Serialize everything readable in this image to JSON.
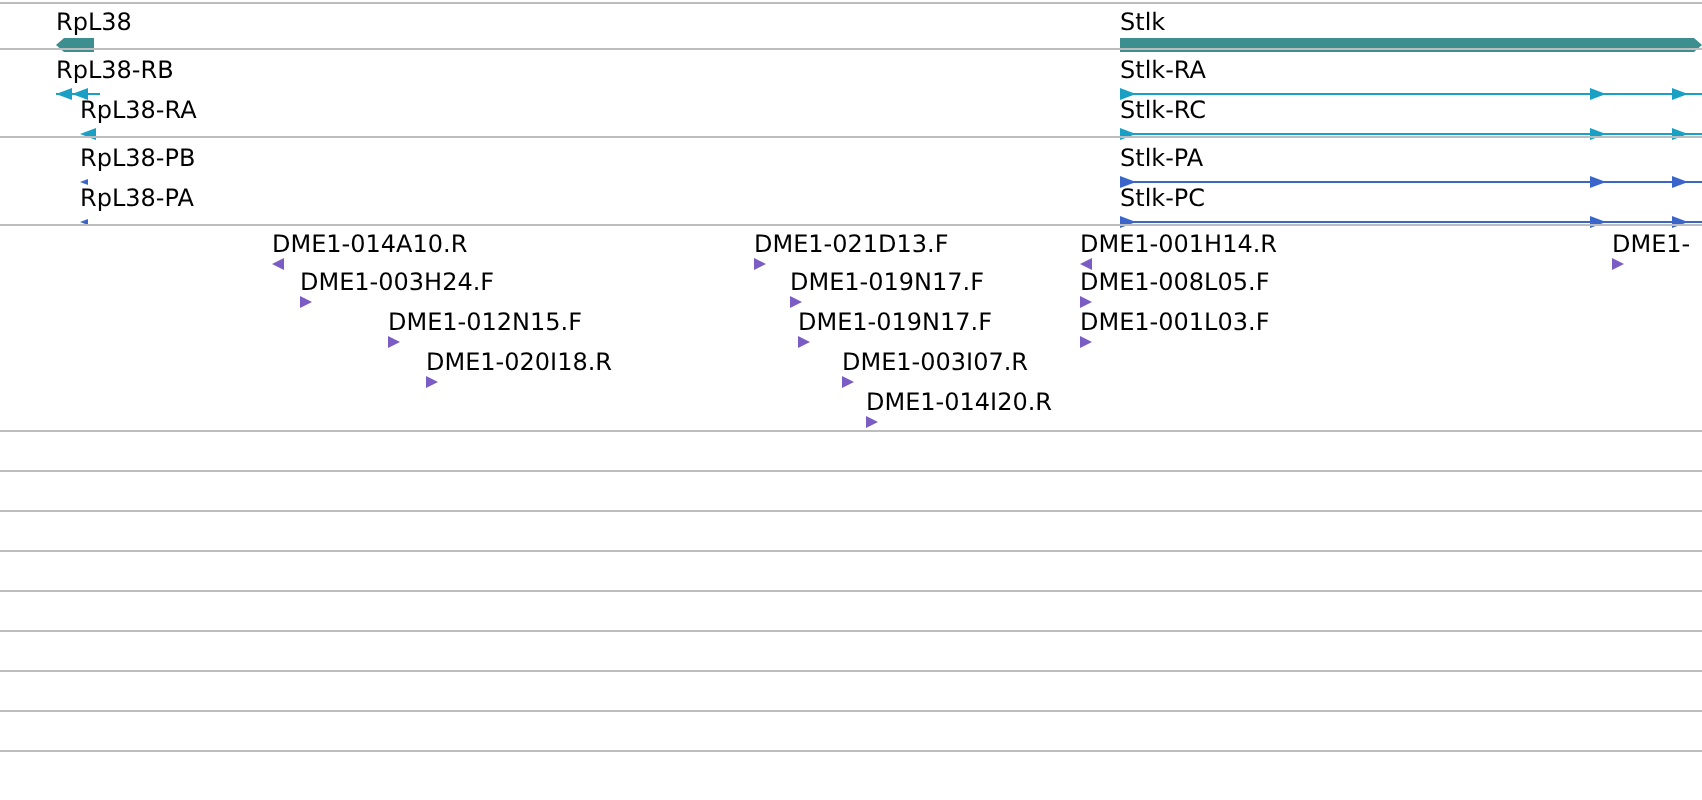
{
  "tracks": [
    {
      "kind": "gene",
      "features": [
        {
          "label": "RpL38",
          "kind": "reverse"
        },
        {
          "label": "Stlk",
          "kind": "forward"
        }
      ]
    },
    {
      "kind": "transcript",
      "features": [
        {
          "label": "RpL38-RB",
          "kind": "reverse"
        },
        {
          "label": "RpL38-RA",
          "kind": "reverse"
        },
        {
          "label": "Stlk-RA",
          "kind": "forward"
        },
        {
          "label": "Stlk-RC",
          "kind": "forward"
        }
      ]
    },
    {
      "kind": "protein",
      "features": [
        {
          "label": "RpL38-PB",
          "kind": "reverse"
        },
        {
          "label": "RpL38-PA",
          "kind": "reverse"
        },
        {
          "label": "Stlk-PA",
          "kind": "forward"
        },
        {
          "label": "Stlk-PC",
          "kind": "forward"
        }
      ]
    },
    {
      "kind": "est",
      "features": [
        {
          "label": "DME1-014A10.R",
          "kind": "reverse"
        },
        {
          "label": "DME1-003H24.F",
          "kind": "forward"
        },
        {
          "label": "DME1-012N15.F",
          "kind": "forward"
        },
        {
          "label": "DME1-020I18.R",
          "kind": "forward"
        },
        {
          "label": "DME1-021D13.F",
          "kind": "forward"
        },
        {
          "label": "DME1-019N17.F",
          "kind": "forward"
        },
        {
          "label": "DME1-019N17.F",
          "kind": "forward"
        },
        {
          "label": "DME1-003I07.R",
          "kind": "forward"
        },
        {
          "label": "DME1-014I20.R",
          "kind": "forward"
        },
        {
          "label": "DME1-001H14.R",
          "kind": "reverse"
        },
        {
          "label": "DME1-008L05.F",
          "kind": "forward"
        },
        {
          "label": "DME1-001L03.F",
          "kind": "forward"
        },
        {
          "label": "DME1-",
          "kind": "forward"
        }
      ]
    },
    {
      "kind": "empty"
    },
    {
      "kind": "empty"
    },
    {
      "kind": "empty"
    },
    {
      "kind": "empty"
    },
    {
      "kind": "empty"
    },
    {
      "kind": "empty"
    },
    {
      "kind": "empty"
    },
    {
      "kind": "empty"
    },
    {
      "kind": "empty"
    }
  ]
}
